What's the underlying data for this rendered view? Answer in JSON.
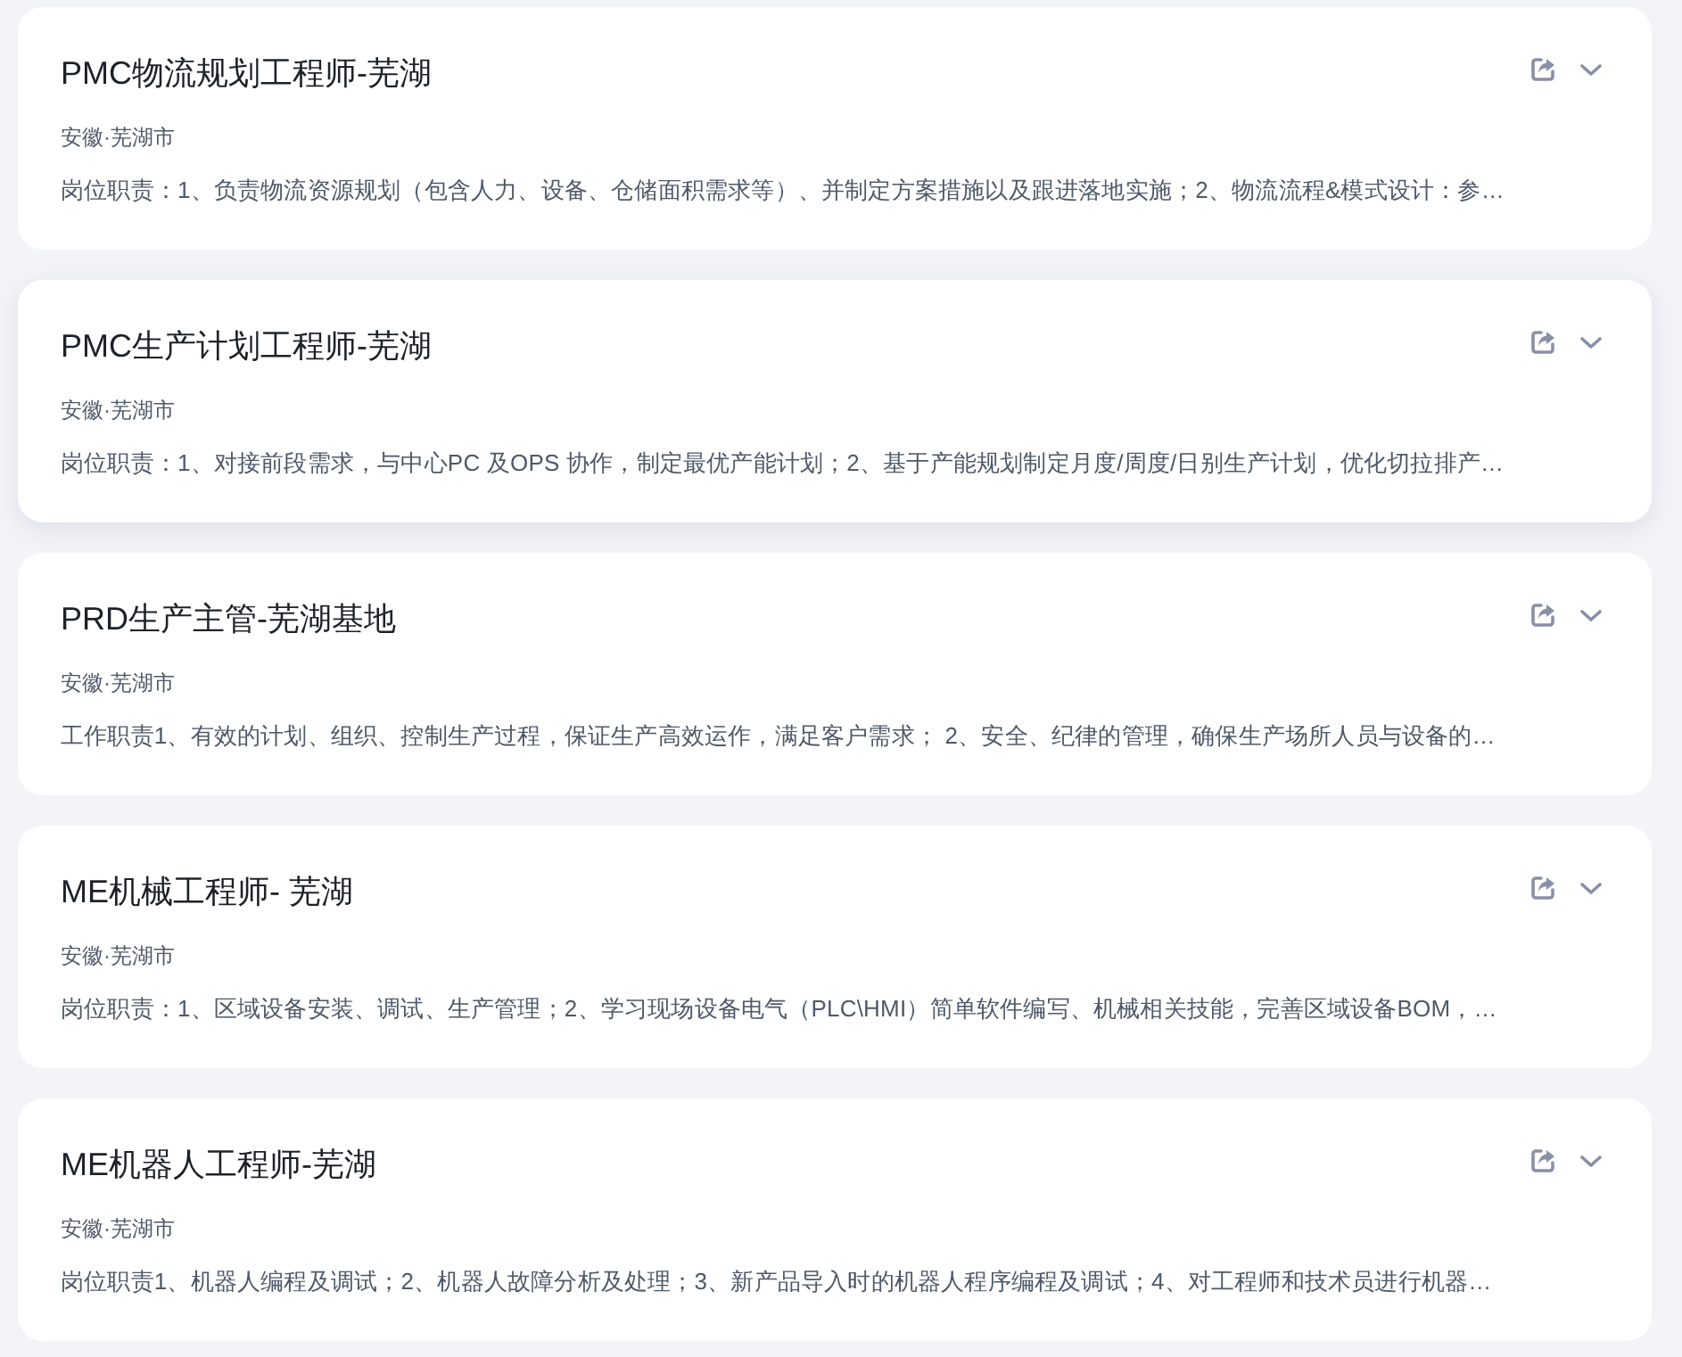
{
  "jobs": [
    {
      "title": "PMC物流规划工程师-芜湖",
      "location": "安徽·芜湖市",
      "description": "岗位职责：1、负责物流资源规划（包含人力、设备、仓储面积需求等）、并制定方案措施以及跟进落地实施；2、物流流程&模式设计：参…",
      "hovered": false
    },
    {
      "title": "PMC生产计划工程师-芜湖",
      "location": "安徽·芜湖市",
      "description": "岗位职责：1、对接前段需求，与中心PC 及OPS 协作，制定最优产能计划；2、基于产能规划制定月度/周度/日别生产计划，优化切拉排产…",
      "hovered": true
    },
    {
      "title": "PRD生产主管-芜湖基地",
      "location": "安徽·芜湖市",
      "description": "工作职责1、有效的计划、组织、控制生产过程，保证生产高效运作，满足客户需求；  2、安全、纪律的管理，确保生产场所人员与设备的…",
      "hovered": false
    },
    {
      "title": "ME机械工程师- 芜湖",
      "location": "安徽·芜湖市",
      "description": "岗位职责：1、区域设备安装、调试、生产管理；2、学习现场设备电气（PLC\\HMI）简单软件编写、机械相关技能，完善区域设备BOM，…",
      "hovered": false
    },
    {
      "title": "ME机器人工程师-芜湖",
      "location": "安徽·芜湖市",
      "description": "岗位职责1、机器人编程及调试；2、机器人故障分析及处理；3、新产品导入时的机器人程序编程及调试；4、对工程师和技术员进行机器…",
      "hovered": false
    }
  ]
}
